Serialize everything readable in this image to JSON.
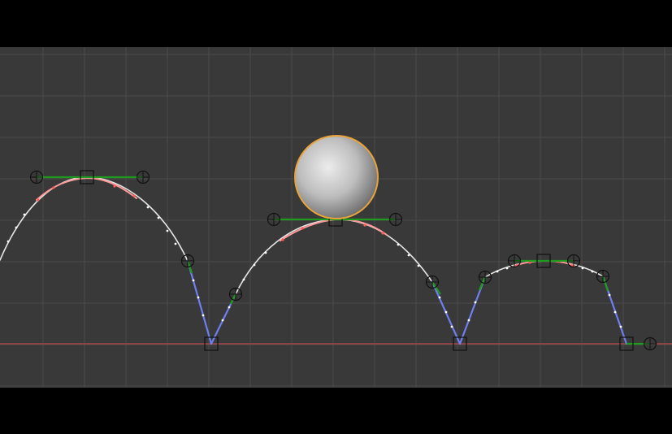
{
  "viewport": {
    "background": "#393939",
    "grid_color": "#4a4a4a",
    "ground_line_color": "#b84848"
  },
  "colors": {
    "curve": "#e6e6e6",
    "curve_selected": "#ff9a9a",
    "handle_left_right": "#1f9a1f",
    "handle_blue": "#6f7ff0",
    "keyframe_marker": "#1a1a1a",
    "ball_outline": "#e8a33a",
    "ball_fill": "#c9c9c9"
  },
  "icons": {
    "keyframe": "square-keyframe-icon",
    "handle": "circle-crosshair-handle-icon",
    "ball": "sphere-icon"
  }
}
